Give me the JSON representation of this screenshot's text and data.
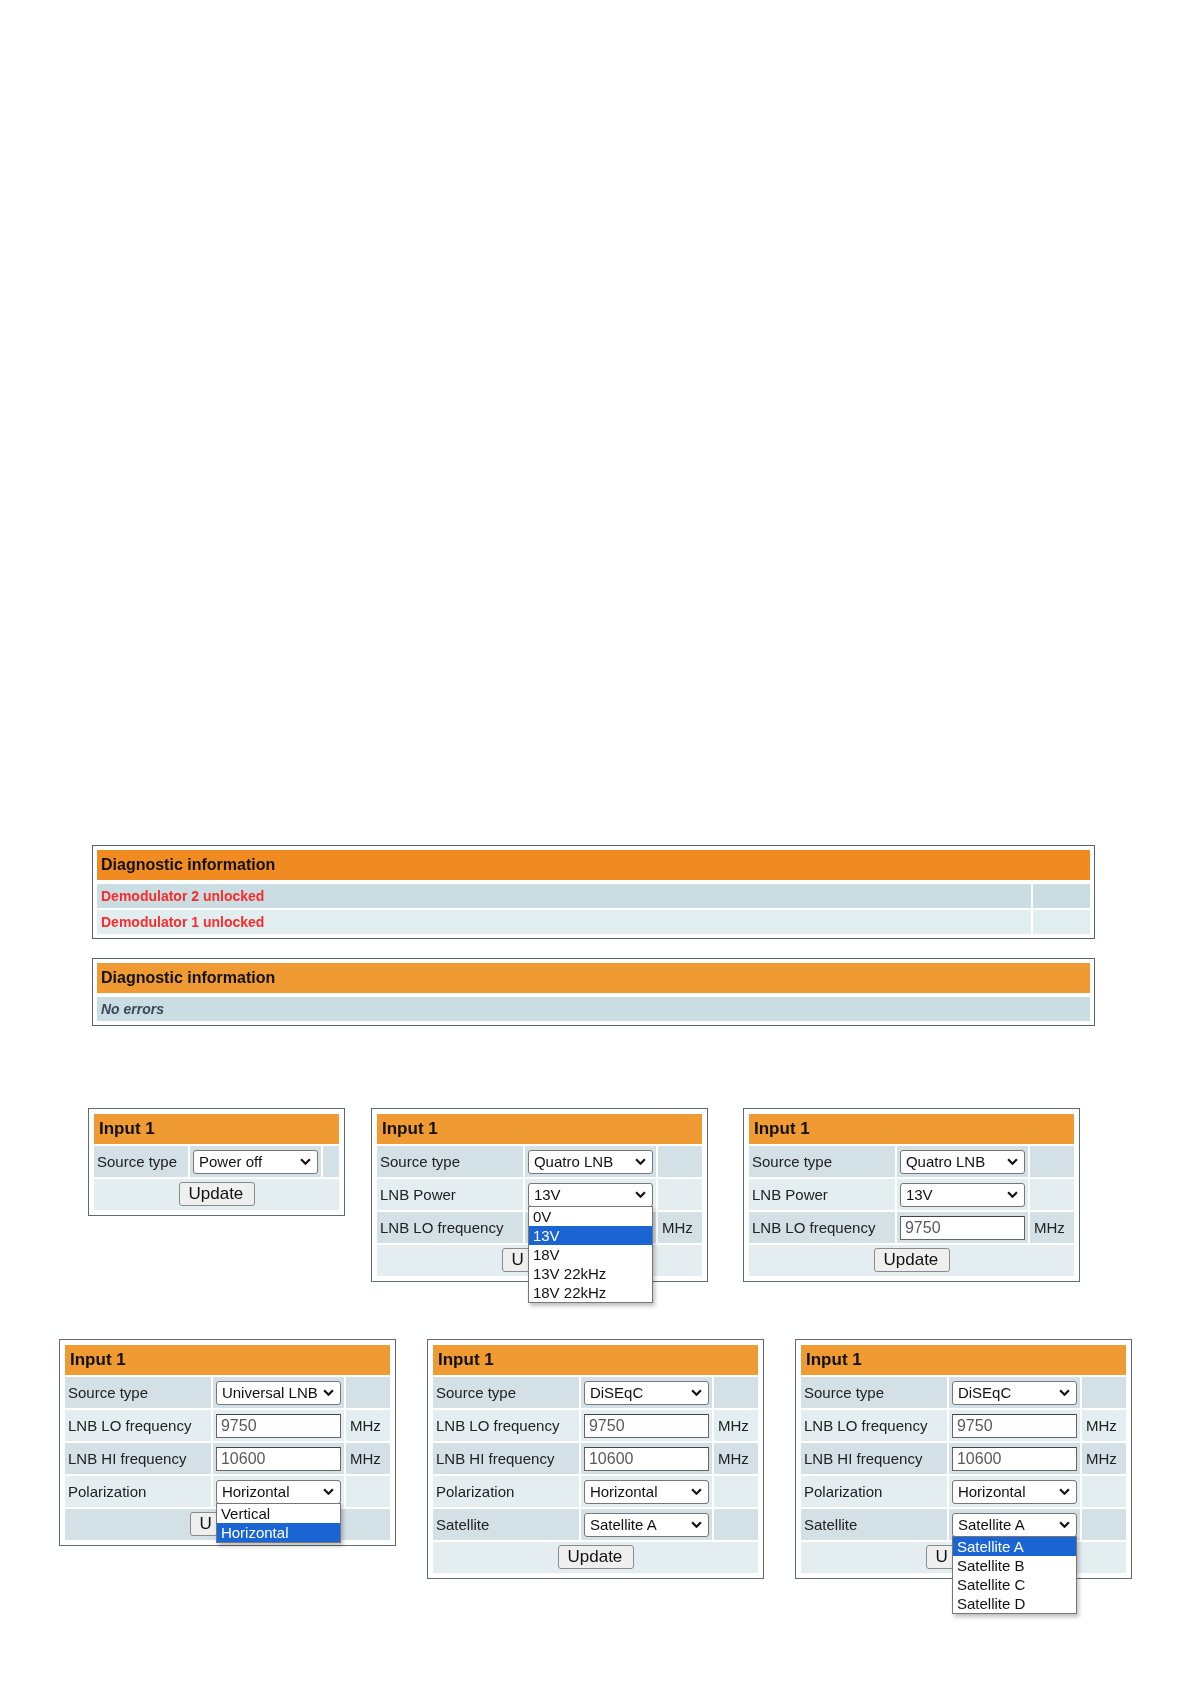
{
  "diagnostics": [
    {
      "title": "Diagnostic information",
      "extra_column": true,
      "rows": [
        {
          "kind": "error",
          "text": "Demodulator 2 unlocked"
        },
        {
          "kind": "error",
          "text": "Demodulator 1 unlocked"
        }
      ]
    },
    {
      "title": "Diagnostic information",
      "extra_column": false,
      "rows": [
        {
          "kind": "ok",
          "text": "No errors"
        }
      ]
    }
  ],
  "panel_rows": [
    [
      {
        "kind": "compact",
        "title": "Input 1",
        "rows": [
          {
            "kind": "select",
            "label": "Source type",
            "value": "Power off"
          }
        ],
        "button": "Update"
      },
      {
        "title": "Input 1",
        "rows": [
          {
            "kind": "select",
            "label": "Source type",
            "value": "Quatro LNB"
          },
          {
            "kind": "select",
            "label": "LNB Power",
            "value": "13V",
            "options": [
              {
                "label": "0V",
                "selected": false
              },
              {
                "label": "13V",
                "selected": true
              },
              {
                "label": "18V",
                "selected": false
              },
              {
                "label": "13V 22kHz",
                "selected": false
              },
              {
                "label": "18V 22kHz",
                "selected": false
              }
            ]
          },
          {
            "kind": "covered",
            "label": "LNB LO frequency",
            "unit": "MHz"
          }
        ],
        "button": "U"
      },
      {
        "title": "Input 1",
        "rows": [
          {
            "kind": "select",
            "label": "Source type",
            "value": "Quatro LNB"
          },
          {
            "kind": "select",
            "label": "LNB Power",
            "value": "13V"
          },
          {
            "kind": "text",
            "label": "LNB LO frequency",
            "value": "9750",
            "unit": "MHz"
          }
        ],
        "button": "Update"
      }
    ],
    [
      {
        "title": "Input 1",
        "rows": [
          {
            "kind": "select",
            "label": "Source type",
            "value": "Universal LNB"
          },
          {
            "kind": "text",
            "label": "LNB LO frequency",
            "value": "9750",
            "unit": "MHz"
          },
          {
            "kind": "text",
            "label": "LNB HI frequency",
            "value": "10600",
            "unit": "MHz"
          },
          {
            "kind": "select",
            "label": "Polarization",
            "value": "Horizontal",
            "options": [
              {
                "label": "Vertical",
                "selected": false
              },
              {
                "label": "Horizontal",
                "selected": true
              }
            ]
          }
        ],
        "button": "U"
      },
      {
        "title": "Input 1",
        "rows": [
          {
            "kind": "select",
            "label": "Source type",
            "value": "DiSEqC"
          },
          {
            "kind": "text",
            "label": "LNB LO frequency",
            "value": "9750",
            "unit": "MHz"
          },
          {
            "kind": "text",
            "label": "LNB HI frequency",
            "value": "10600",
            "unit": "MHz"
          },
          {
            "kind": "select",
            "label": "Polarization",
            "value": "Horizontal"
          },
          {
            "kind": "select",
            "label": "Satellite",
            "value": "Satellite A"
          }
        ],
        "button": "Update"
      },
      {
        "title": "Input 1",
        "rows": [
          {
            "kind": "select",
            "label": "Source type",
            "value": "DiSEqC"
          },
          {
            "kind": "text",
            "label": "LNB LO frequency",
            "value": "9750",
            "unit": "MHz"
          },
          {
            "kind": "text",
            "label": "LNB HI frequency",
            "value": "10600",
            "unit": "MHz"
          },
          {
            "kind": "select",
            "label": "Polarization",
            "value": "Horizontal"
          },
          {
            "kind": "select",
            "label": "Satellite",
            "value": "Satellite A",
            "options": [
              {
                "label": "Satellite A",
                "selected": true
              },
              {
                "label": "Satellite B",
                "selected": false
              },
              {
                "label": "Satellite C",
                "selected": false
              },
              {
                "label": "Satellite D",
                "selected": false
              }
            ]
          }
        ],
        "button": "U"
      }
    ]
  ]
}
